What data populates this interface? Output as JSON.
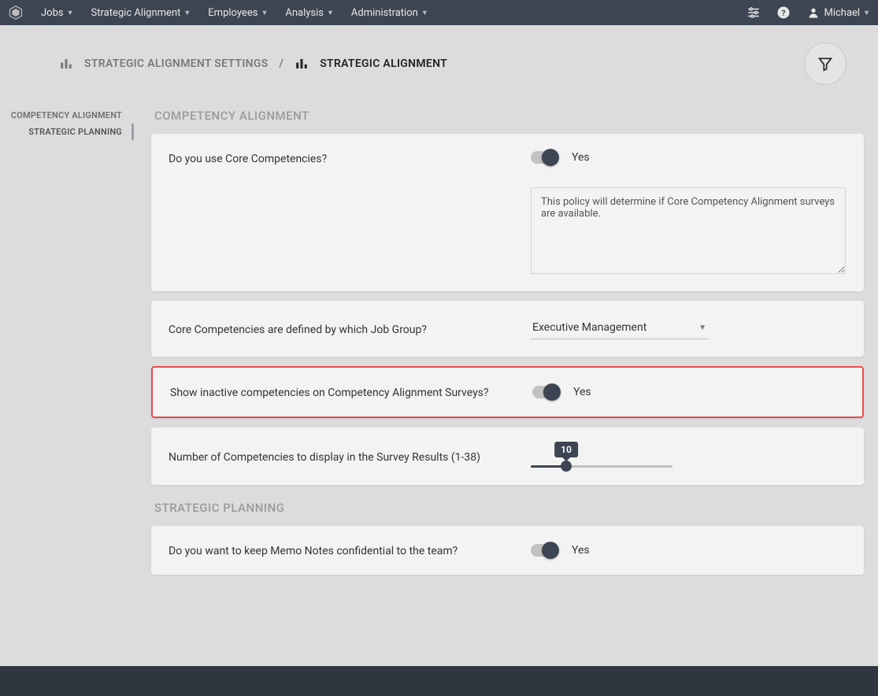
{
  "nav": {
    "items": [
      "Jobs",
      "Strategic Alignment",
      "Employees",
      "Analysis",
      "Administration"
    ],
    "user": "Michael"
  },
  "breadcrumb": {
    "parent": "STRATEGIC ALIGNMENT SETTINGS",
    "sep": "/",
    "current": "STRATEGIC ALIGNMENT"
  },
  "sidebar": {
    "items": [
      {
        "label": "COMPETENCY ALIGNMENT"
      },
      {
        "label": "STRATEGIC PLANNING"
      }
    ]
  },
  "sections": {
    "competency": {
      "title": "COMPETENCY ALIGNMENT",
      "card1": {
        "label": "Do you use Core Competencies?",
        "toggle_label": "Yes",
        "desc": "This policy will determine if Core Competency Alignment surveys are available."
      },
      "card2": {
        "label": "Core Competencies are defined by which Job Group?",
        "select_value": "Executive Management"
      },
      "card3": {
        "label": "Show inactive competencies on Competency Alignment Surveys?",
        "toggle_label": "Yes"
      },
      "card4": {
        "label": "Number of Competencies to display in the Survey Results (1-38)",
        "slider_value": "10",
        "slider_min": 1,
        "slider_max": 38
      }
    },
    "planning": {
      "title": "STRATEGIC PLANNING",
      "card1": {
        "label": "Do you want to keep Memo Notes confidential to the team?",
        "toggle_label": "Yes"
      }
    }
  }
}
